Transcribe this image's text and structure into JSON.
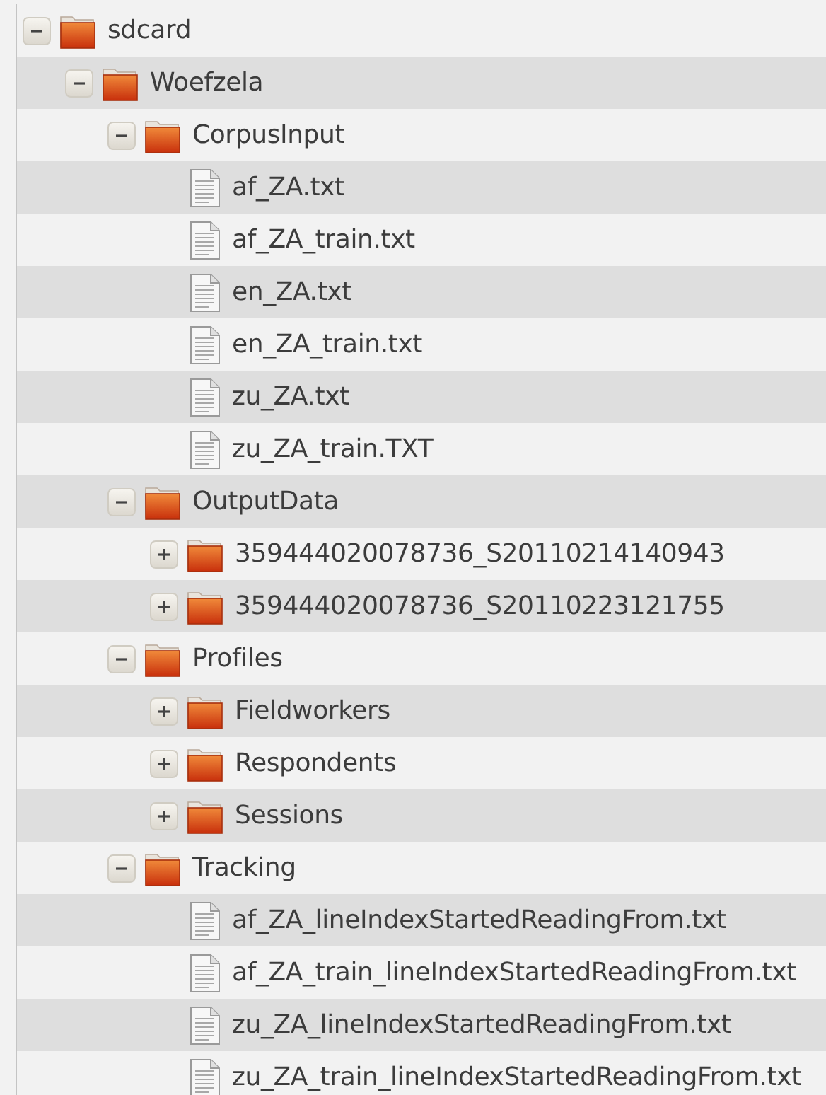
{
  "tree": [
    {
      "kind": "folder",
      "name": "sdcard",
      "expanded": true,
      "children": [
        {
          "kind": "folder",
          "name": "Woefzela",
          "expanded": true,
          "children": [
            {
              "kind": "folder",
              "name": "CorpusInput",
              "expanded": true,
              "children": [
                {
                  "kind": "file",
                  "name": "af_ZA.txt"
                },
                {
                  "kind": "file",
                  "name": "af_ZA_train.txt"
                },
                {
                  "kind": "file",
                  "name": "en_ZA.txt"
                },
                {
                  "kind": "file",
                  "name": "en_ZA_train.txt"
                },
                {
                  "kind": "file",
                  "name": "zu_ZA.txt"
                },
                {
                  "kind": "file",
                  "name": "zu_ZA_train.TXT"
                }
              ]
            },
            {
              "kind": "folder",
              "name": "OutputData",
              "expanded": true,
              "children": [
                {
                  "kind": "folder",
                  "name": "359444020078736_S20110214140943",
                  "expanded": false
                },
                {
                  "kind": "folder",
                  "name": "359444020078736_S20110223121755",
                  "expanded": false
                }
              ]
            },
            {
              "kind": "folder",
              "name": "Profiles",
              "expanded": true,
              "children": [
                {
                  "kind": "folder",
                  "name": "Fieldworkers",
                  "expanded": false
                },
                {
                  "kind": "folder",
                  "name": "Respondents",
                  "expanded": false
                },
                {
                  "kind": "folder",
                  "name": "Sessions",
                  "expanded": false
                }
              ]
            },
            {
              "kind": "folder",
              "name": "Tracking",
              "expanded": true,
              "children": [
                {
                  "kind": "file",
                  "name": "af_ZA_lineIndexStartedReadingFrom.txt"
                },
                {
                  "kind": "file",
                  "name": "af_ZA_train_lineIndexStartedReadingFrom.txt"
                },
                {
                  "kind": "file",
                  "name": "zu_ZA_lineIndexStartedReadingFrom.txt"
                },
                {
                  "kind": "file",
                  "name": "zu_ZA_train_lineIndexStartedReadingFrom.txt"
                }
              ]
            }
          ]
        }
      ]
    }
  ]
}
